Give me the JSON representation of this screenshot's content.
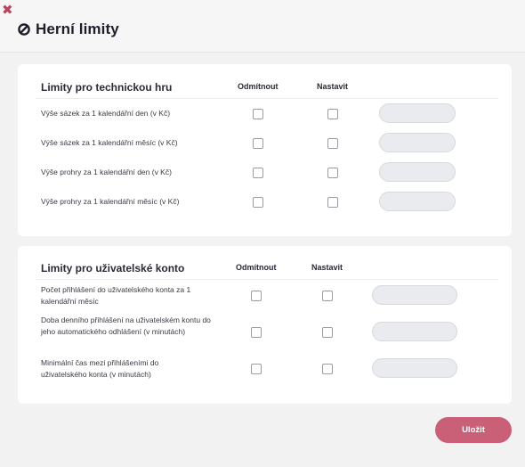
{
  "header": {
    "close_glyph": "✖",
    "title": "Herní limity",
    "title_icon": "slashed-circle-icon"
  },
  "technical_game": {
    "title": "Limity pro technickou hru",
    "col_decline": "Odmítnout",
    "col_set": "Nastavit",
    "rows": [
      {
        "label": "Výše sázek za 1 kalendářní den (v Kč)",
        "value": ""
      },
      {
        "label": "Výše sázek za 1 kalendářní měsíc (v Kč)",
        "value": ""
      },
      {
        "label": "Výše prohry za 1 kalendářní den (v Kč)",
        "value": ""
      },
      {
        "label": "Výše prohry za 1 kalendářní měsíc (v Kč)",
        "value": ""
      }
    ]
  },
  "user_account": {
    "title": "Limity pro uživatelské konto",
    "col_decline": "Odmítnout",
    "col_set": "Nastavit",
    "rows": [
      {
        "label": "Počet přihlášení do uživatelského konta za 1 kalendářní měsíc",
        "value": ""
      },
      {
        "label": "Doba denního přihlášení na uživatelském kontu do jeho automatického odhlášení (v minutách)",
        "value": ""
      },
      {
        "label": "Minimální čas mezi přihlášeními do uživatelského konta (v minutách)",
        "value": ""
      }
    ]
  },
  "actions": {
    "save_label": "Uložit"
  },
  "colors": {
    "accent": "#c96077",
    "close": "#b8465a",
    "field_bg": "#e9ebef"
  }
}
